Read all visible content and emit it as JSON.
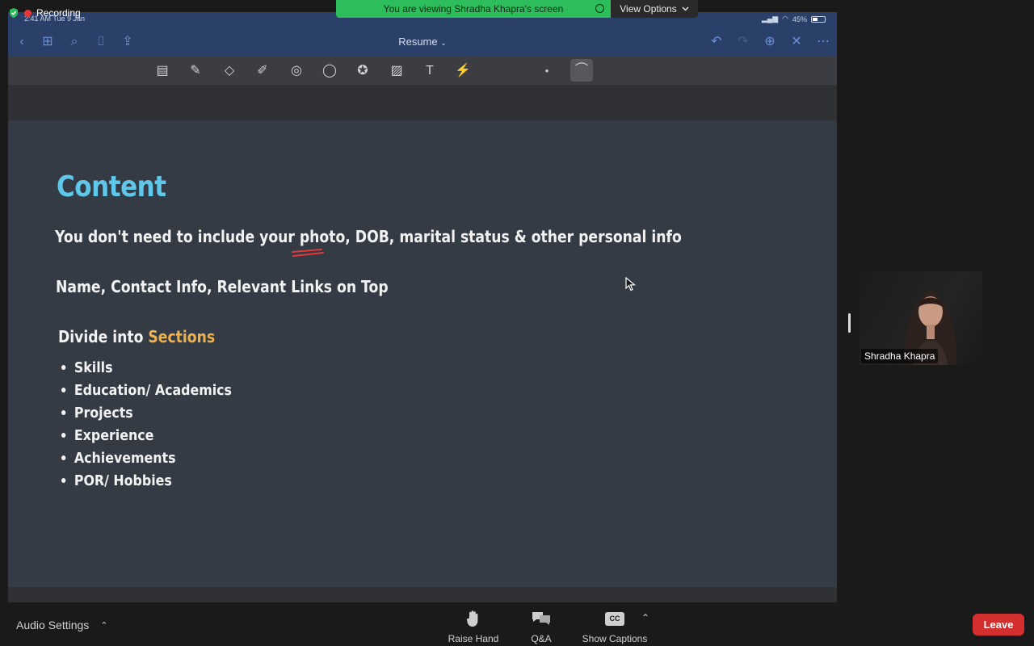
{
  "recording": {
    "label": "Recording",
    "ipad_time": "2:41 AM  Tue 9 Jan"
  },
  "banner": {
    "message": "You are viewing Shradha Khapra's screen",
    "view_options": "View Options"
  },
  "ipad": {
    "battery": "45%",
    "nav_title": "Resume",
    "tools": [
      "page-icon",
      "pen-icon",
      "eraser-icon",
      "highlighter-icon",
      "shapes-icon",
      "lasso-icon",
      "sticker-icon",
      "image-icon",
      "textbox-icon",
      "laser-icon",
      "dot-icon",
      "stroke-icon"
    ]
  },
  "slide": {
    "heading": "Content",
    "line1": "You don't need to include your photo, DOB, marital status & other personal info",
    "line2": "Name, Contact Info, Relevant Links on Top",
    "line3_prefix": "Divide into ",
    "line3_highlight": "Sections",
    "bullets": [
      "Skills",
      "Education/ Academics",
      "Projects",
      "Experience",
      "Achievements",
      "POR/ Hobbies"
    ],
    "colors": {
      "heading": "#5fc8ea",
      "highlight": "#f0b04a",
      "text": "#f2f2f2"
    }
  },
  "participant": {
    "name": "Shradha Khapra"
  },
  "controls": {
    "audio_settings": "Audio Settings",
    "raise_hand": "Raise Hand",
    "qa": "Q&A",
    "show_captions": "Show Captions",
    "cc": "CC",
    "leave": "Leave"
  }
}
